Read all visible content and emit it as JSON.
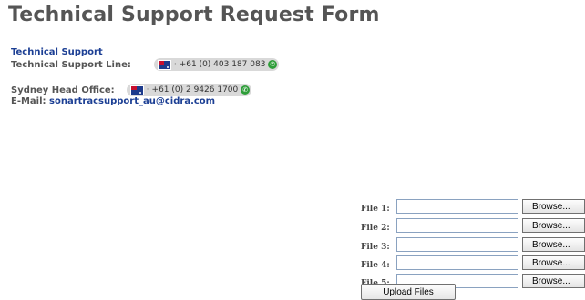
{
  "page": {
    "title": "Technical Support Request Form"
  },
  "contact": {
    "section_title": "Technical Support",
    "support_line_label": "Technical Support Line:",
    "support_line_number": "+61 (0) 403 187 083",
    "office_label": "Sydney Head Office:",
    "office_number": "+61 (0) 2 9426 1700",
    "email_label": "E-Mail:",
    "email_address": "sonartracsupport_au@cidra.com"
  },
  "upload": {
    "files": [
      {
        "label": "File 1:",
        "value": "",
        "button": "Browse..."
      },
      {
        "label": "File 2:",
        "value": "",
        "button": "Browse..."
      },
      {
        "label": "File 3:",
        "value": "",
        "button": "Browse..."
      },
      {
        "label": "File 4:",
        "value": "",
        "button": "Browse..."
      },
      {
        "label": "File 5:",
        "value": "",
        "button": "Browse..."
      }
    ],
    "submit_label": "Upload Files"
  },
  "colors": {
    "title": "#555555",
    "link": "#1c3f94",
    "phone_icon": "#2f9e3a"
  },
  "icons": {
    "flag": "australia-flag-icon",
    "phone": "phone-icon"
  }
}
